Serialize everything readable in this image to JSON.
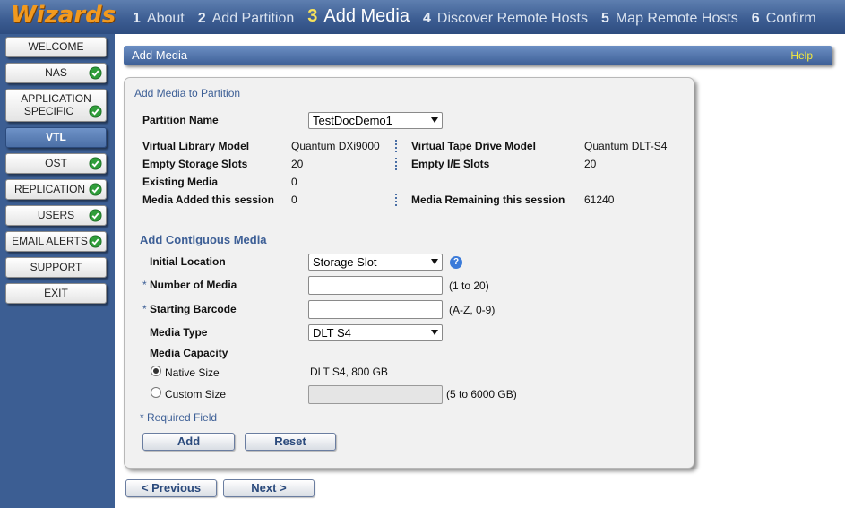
{
  "header": {
    "brand": "Wizards",
    "steps": [
      {
        "num": "1",
        "label": "About"
      },
      {
        "num": "2",
        "label": "Add Partition"
      },
      {
        "num": "3",
        "label": "Add Media"
      },
      {
        "num": "4",
        "label": "Discover Remote Hosts"
      },
      {
        "num": "5",
        "label": "Map Remote Hosts"
      },
      {
        "num": "6",
        "label": "Confirm"
      }
    ],
    "active_step": "3"
  },
  "sidebar": {
    "items": [
      {
        "label": "WELCOME",
        "checked": false,
        "active": false
      },
      {
        "label": "NAS",
        "checked": true,
        "active": false
      },
      {
        "label_line1": "APPLICATION",
        "label_line2": "SPECIFIC",
        "checked": true,
        "active": false
      },
      {
        "label": "VTL",
        "checked": false,
        "active": true
      },
      {
        "label": "OST",
        "checked": true,
        "active": false
      },
      {
        "label": "REPLICATION",
        "checked": true,
        "active": false
      },
      {
        "label": "USERS",
        "checked": true,
        "active": false
      },
      {
        "label": "EMAIL ALERTS",
        "checked": true,
        "active": false
      },
      {
        "label": "SUPPORT",
        "checked": false,
        "active": false
      },
      {
        "label": "EXIT",
        "checked": false,
        "active": false
      }
    ]
  },
  "panel": {
    "title": "Add Media",
    "help_label": "Help"
  },
  "form": {
    "section_link": "Add Media to Partition",
    "partition": {
      "label": "Partition Name",
      "value": "TestDocDemo1"
    },
    "info": {
      "virtual_library_model": {
        "label": "Virtual Library Model",
        "value": "Quantum DXi9000"
      },
      "virtual_tape_drive_model": {
        "label": "Virtual Tape Drive Model",
        "value": "Quantum DLT-S4"
      },
      "empty_storage_slots": {
        "label": "Empty Storage Slots",
        "value": "20"
      },
      "empty_ie_slots": {
        "label": "Empty I/E Slots",
        "value": "20"
      },
      "existing_media": {
        "label": "Existing Media",
        "value": "0"
      },
      "media_added_session": {
        "label": "Media Added this session",
        "value": "0"
      },
      "media_remaining_session": {
        "label": "Media Remaining this session",
        "value": "61240"
      }
    },
    "contiguous_heading": "Add Contiguous Media",
    "initial_location": {
      "label": "Initial Location",
      "value": "Storage Slot"
    },
    "number_of_media": {
      "label": "Number of Media",
      "value": "",
      "hint": "(1 to 20)"
    },
    "starting_barcode": {
      "label": "Starting Barcode",
      "value": "",
      "hint": "(A-Z, 0-9)"
    },
    "media_type": {
      "label": "Media Type",
      "value": "DLT S4"
    },
    "media_capacity": {
      "label": "Media Capacity",
      "native": {
        "label": "Native Size",
        "value": "DLT S4, 800 GB",
        "checked": true
      },
      "custom": {
        "label": "Custom Size",
        "value": "",
        "hint": "(5 to 6000 GB)",
        "checked": false
      }
    },
    "required_mark": "*",
    "required_note": "* Required Field",
    "add_label": "Add",
    "reset_label": "Reset"
  },
  "nav": {
    "previous_label": "< Previous",
    "next_label": "Next >"
  },
  "colors": {
    "brand": "#f29a1f",
    "header_blue": "#3d5e93",
    "active_step": "#f7e25a",
    "help_link": "#f5ea3a",
    "check_green": "#2f9e3a"
  }
}
